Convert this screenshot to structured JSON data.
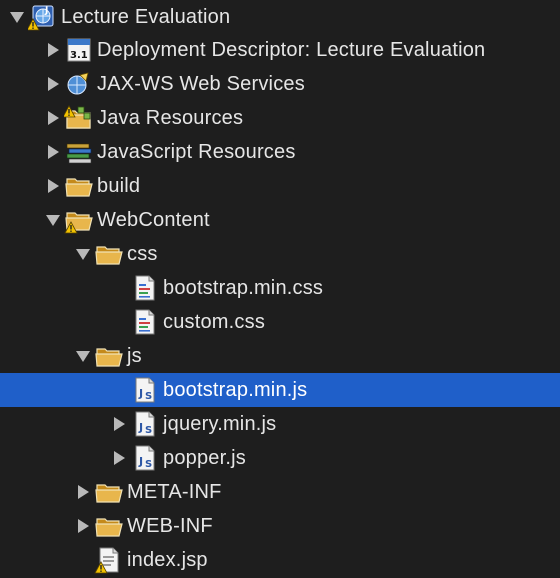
{
  "tree": {
    "project": {
      "label": "Lecture Evaluation",
      "icon": "web-project-icon",
      "state": "expanded"
    },
    "nodes": [
      {
        "label": "Deployment Descriptor: Lecture Evaluation",
        "icon": "deployment-descriptor-icon",
        "badge": "3.1",
        "state": "collapsed"
      },
      {
        "label": "JAX-WS Web Services",
        "icon": "web-services-icon",
        "state": "collapsed"
      },
      {
        "label": "Java Resources",
        "icon": "java-resources-icon",
        "state": "collapsed"
      },
      {
        "label": "JavaScript Resources",
        "icon": "javascript-resources-icon",
        "state": "collapsed"
      },
      {
        "label": "build",
        "icon": "folder-icon",
        "state": "collapsed"
      },
      {
        "label": "WebContent",
        "icon": "folder-warning-icon",
        "state": "expanded"
      },
      {
        "label": "css",
        "icon": "folder-open-icon",
        "state": "expanded"
      },
      {
        "label": "bootstrap.min.css",
        "icon": "css-file-icon",
        "state": "leaf"
      },
      {
        "label": "custom.css",
        "icon": "css-file-icon",
        "state": "leaf"
      },
      {
        "label": "js",
        "icon": "folder-open-icon",
        "state": "expanded"
      },
      {
        "label": "bootstrap.min.js",
        "icon": "js-file-icon",
        "state": "leaf",
        "selected": true
      },
      {
        "label": "jquery.min.js",
        "icon": "js-file-icon",
        "state": "collapsed"
      },
      {
        "label": "popper.js",
        "icon": "js-file-icon",
        "state": "collapsed"
      },
      {
        "label": "META-INF",
        "icon": "folder-icon",
        "state": "collapsed"
      },
      {
        "label": "WEB-INF",
        "icon": "folder-icon",
        "state": "collapsed"
      },
      {
        "label": "index.jsp",
        "icon": "jsp-file-warning-icon",
        "state": "leaf"
      }
    ]
  },
  "colors": {
    "background": "#1e1e1e",
    "selection": "#1f5fc9",
    "text": "#e6e6e6",
    "folder": "#e8b64c",
    "warning": "#f2c200"
  }
}
